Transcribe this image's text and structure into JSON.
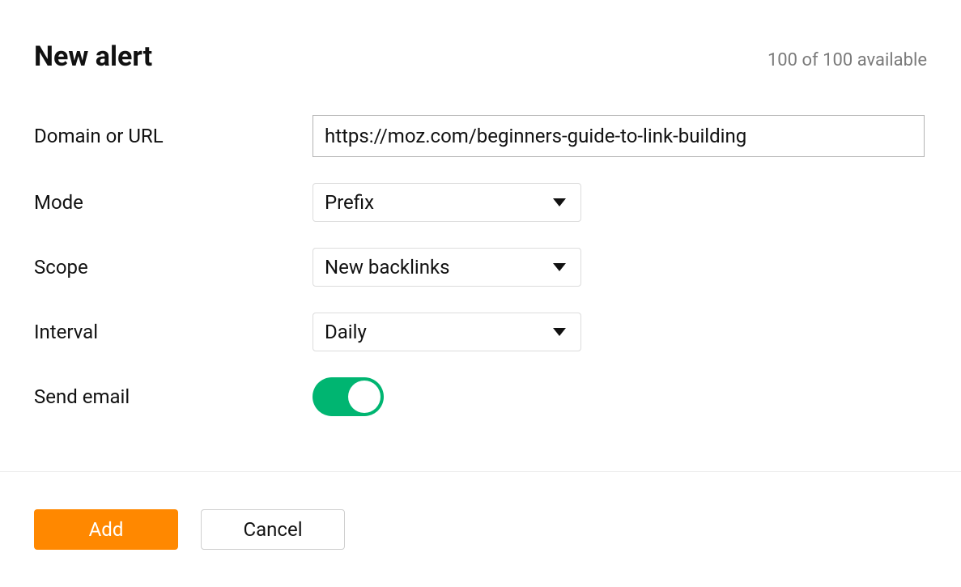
{
  "header": {
    "title": "New alert",
    "availability": "100 of 100 available"
  },
  "labels": {
    "domain_or_url": "Domain or URL",
    "mode": "Mode",
    "scope": "Scope",
    "interval": "Interval",
    "send_email": "Send email"
  },
  "fields": {
    "domain_or_url": "https://moz.com/beginners-guide-to-link-building",
    "mode": "Prefix",
    "scope": "New backlinks",
    "interval": "Daily",
    "send_email": true
  },
  "buttons": {
    "add": "Add",
    "cancel": "Cancel"
  },
  "colors": {
    "primary": "#ff8800",
    "toggle_on": "#00b571"
  }
}
